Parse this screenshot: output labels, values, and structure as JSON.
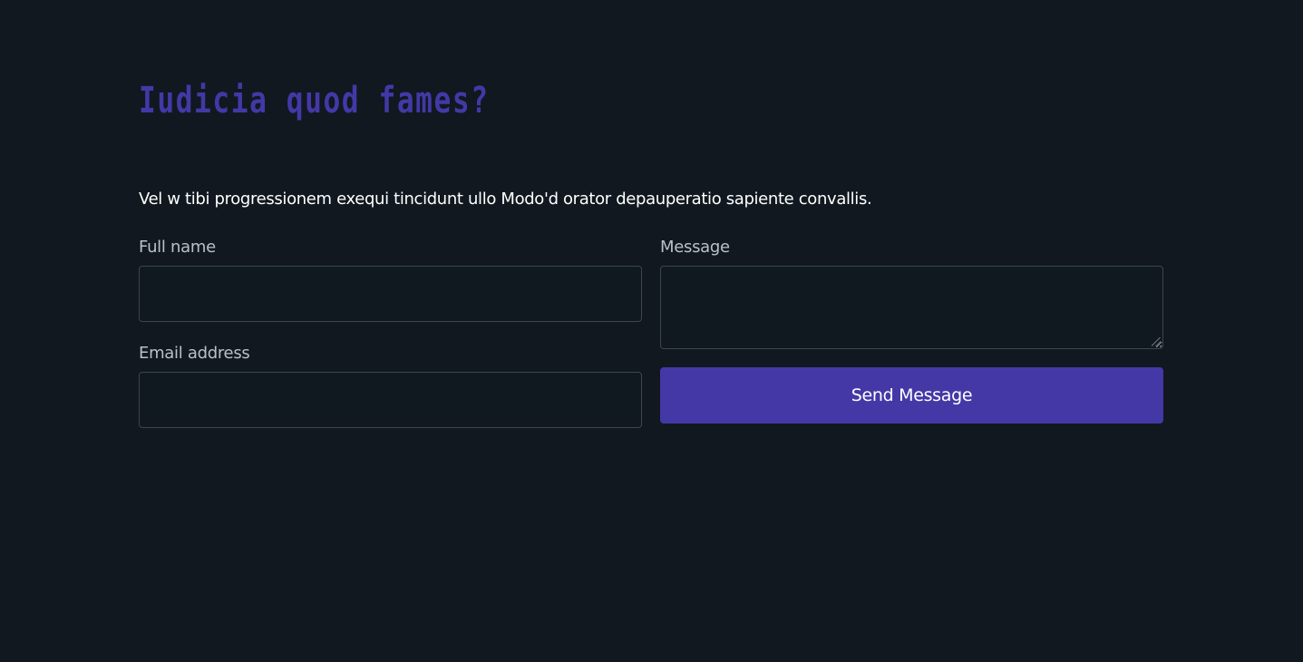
{
  "contact": {
    "title": "Iudicia quod fames?",
    "intro": "Vel w tibi progressionem exequi tincidunt ullo Modo'd orator depauperatio sapiente convallis.",
    "full_name": {
      "label": "Full name",
      "value": "",
      "placeholder": ""
    },
    "email": {
      "label": "Email address",
      "value": "",
      "placeholder": ""
    },
    "message": {
      "label": "Message",
      "value": "",
      "placeholder": ""
    },
    "send_label": "Send Message"
  },
  "colors": {
    "background": "#111820",
    "accent": "#4438a7",
    "text": "#ffffff",
    "label": "#b9c0ca",
    "field_border": "#3a4652"
  }
}
